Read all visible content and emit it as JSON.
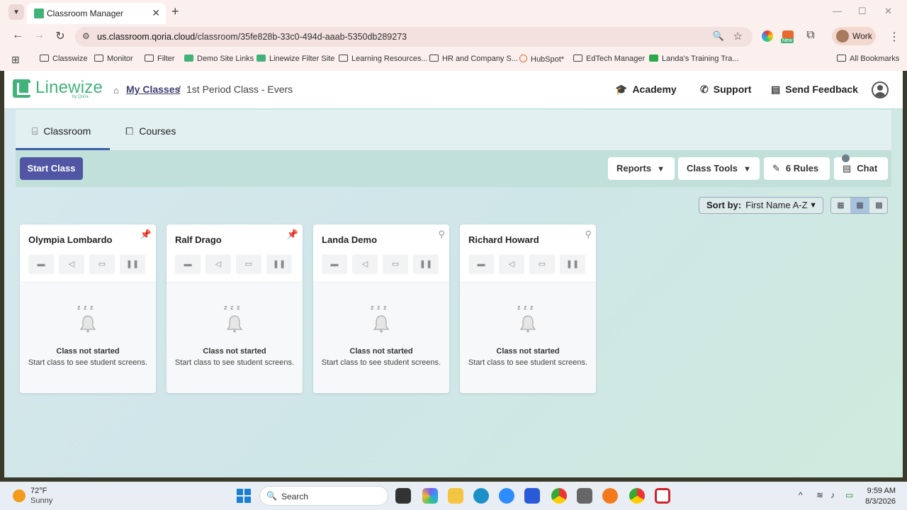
{
  "browser": {
    "tab_title": "Classroom Manager",
    "url_host": "us.classroom.qoria.cloud",
    "url_path": "/classroom/35fe828b-33c0-494d-aaab-5350db289273",
    "profile_label": "Work",
    "new_badge": "New",
    "bookmarks": [
      {
        "label": "Classwize",
        "icon": "folder-icon"
      },
      {
        "label": "Monitor",
        "icon": "folder-icon"
      },
      {
        "label": "Filter",
        "icon": "folder-icon"
      },
      {
        "label": "Demo Site Links",
        "icon": "linewize-icon"
      },
      {
        "label": "Linewize Filter Site",
        "icon": "linewize-icon"
      },
      {
        "label": "Learning Resources...",
        "icon": "folder-icon"
      },
      {
        "label": "HR and Company S...",
        "icon": "folder-icon"
      },
      {
        "label": "HubSpot*",
        "icon": "hubspot-icon"
      },
      {
        "label": "EdTech Manager",
        "icon": "folder-icon"
      },
      {
        "label": "Landa's Training Tra...",
        "icon": "line-icon"
      }
    ],
    "all_bookmarks": "All Bookmarks"
  },
  "app": {
    "logo_text": "Linewize",
    "logo_sub": "by Qoria",
    "breadcrumb": {
      "link": "My Classes",
      "separator": "/",
      "current": "1st Period Class - Evers"
    },
    "header_links": {
      "academy": "Academy",
      "support": "Support",
      "feedback": "Send Feedback"
    },
    "tabs": {
      "classroom": "Classroom",
      "courses": "Courses"
    },
    "toolbar": {
      "start": "Start Class",
      "reports": "Reports",
      "class_tools": "Class Tools",
      "rules": "6 Rules",
      "chat": "Chat"
    },
    "sort": {
      "label": "Sort by:",
      "value": "First Name A-Z"
    },
    "students": [
      {
        "name": "Olympia Lombardo",
        "pinned": true
      },
      {
        "name": "Ralf Drago",
        "pinned": true
      },
      {
        "name": "Landa Demo",
        "pinned": false
      },
      {
        "name": "Richard Howard",
        "pinned": false
      }
    ],
    "not_started_title": "Class not started",
    "not_started_sub": "Start class to see student screens.",
    "zzz": "z z z"
  },
  "taskbar": {
    "temp": "72°F",
    "weather": "Sunny",
    "search": "Search",
    "time": "9:59 AM",
    "date": "8/3/2026"
  },
  "colors": {
    "brand_green": "#41b37a",
    "start_button": "#5055a4",
    "pin_active": "#e48a2a"
  }
}
